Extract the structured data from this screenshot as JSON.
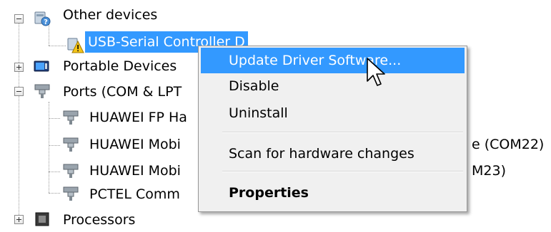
{
  "tree": {
    "other_devices": "Other devices",
    "usb_serial": "USB-Serial Controller D",
    "portable_devices": "Portable Devices",
    "ports": "Ports (COM & LPT",
    "port_items": [
      "HUAWEI FP Ha",
      "HUAWEI Mobi",
      "HUAWEI Mobi",
      "PCTEL Comm"
    ],
    "port_item_tail_1": "e (COM22)",
    "port_item_tail_2": "M23)",
    "processors": "Processors"
  },
  "context_menu": {
    "update_driver": "Update Driver Software...",
    "disable": "Disable",
    "uninstall": "Uninstall",
    "scan": "Scan for hardware changes",
    "properties": "Properties"
  },
  "colors": {
    "selection": "#3399ff",
    "menu_background": "#f0f0f0"
  }
}
